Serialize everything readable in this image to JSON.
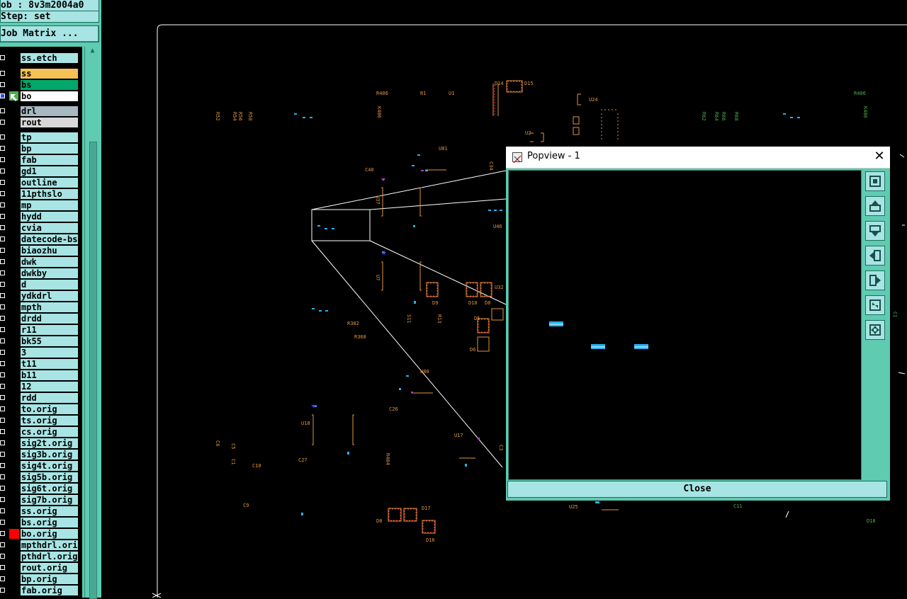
{
  "header": {
    "job": "ob : 8v3m2004a0",
    "step": "Step: set",
    "job_matrix": "Job Matrix ..."
  },
  "layers": [
    {
      "name": "ss.etch",
      "bg": "#a8e4e4"
    },
    {
      "name": "ss",
      "bg": "#f4c256"
    },
    {
      "name": "bs",
      "bg": "#00a86b"
    },
    {
      "name": "bo",
      "bg": "#ffffff",
      "active": true
    },
    {
      "name": "drl",
      "bg": "#a8b8c0"
    },
    {
      "name": "rout",
      "bg": "#d8d8d8"
    },
    {
      "name": "tp"
    },
    {
      "name": "bp"
    },
    {
      "name": "fab"
    },
    {
      "name": "gd1"
    },
    {
      "name": "outline"
    },
    {
      "name": "11pthslo"
    },
    {
      "name": "mp"
    },
    {
      "name": "hydd"
    },
    {
      "name": "cvia"
    },
    {
      "name": "datecode-bs"
    },
    {
      "name": "biaozhu"
    },
    {
      "name": "dwk"
    },
    {
      "name": "dwkby"
    },
    {
      "name": "d"
    },
    {
      "name": "ydkdrl"
    },
    {
      "name": "mpth"
    },
    {
      "name": "drdd"
    },
    {
      "name": "r11"
    },
    {
      "name": "bk55"
    },
    {
      "name": "3"
    },
    {
      "name": "t11"
    },
    {
      "name": "b11"
    },
    {
      "name": "12"
    },
    {
      "name": "rdd"
    },
    {
      "name": "to.orig"
    },
    {
      "name": "ts.orig"
    },
    {
      "name": "cs.orig"
    },
    {
      "name": "sig2t.orig"
    },
    {
      "name": "sig3b.orig"
    },
    {
      "name": "sig4t.orig"
    },
    {
      "name": "sig5b.orig"
    },
    {
      "name": "sig6t.orig"
    },
    {
      "name": "sig7b.orig"
    },
    {
      "name": "ss.orig"
    },
    {
      "name": "bs.orig"
    },
    {
      "name": "bo.orig",
      "marker": "#ff0000"
    },
    {
      "name": "mpthdrl.orig"
    },
    {
      "name": "pthdrl.orig"
    },
    {
      "name": "rout.orig"
    },
    {
      "name": "bp.orig"
    },
    {
      "name": "fab.orig"
    }
  ],
  "board_labels": {
    "orange": [
      "R406",
      "R43",
      "R52",
      "R54",
      "R58",
      "U8",
      "C40",
      "C38",
      "U7",
      "D8",
      "D10",
      "D6",
      "D9",
      "R382",
      "R368",
      "C26",
      "U18",
      "C27",
      "C9",
      "C10",
      "C6",
      "C5",
      "U17",
      "D16",
      "D17",
      "D15",
      "D14",
      "U15",
      "U24",
      "U2",
      "C3",
      "R406",
      "R402"
    ],
    "green": [
      "R60",
      "R64",
      "R58",
      "R406",
      "R402",
      "C3",
      "D8",
      "C1"
    ]
  },
  "popview": {
    "title": "Popview - 1",
    "close_label": "Close",
    "tools": [
      "fit-icon",
      "pan-up-icon",
      "pan-down-icon",
      "pan-left-icon",
      "pan-right-icon",
      "zoom-out-icon",
      "zoom-in-icon"
    ]
  },
  "colors": {
    "panel": "#5fcbb0",
    "button": "#a8e4e4",
    "canvas": "#000000",
    "pad_blue": "#2ab0f0",
    "silk_orange": "#e09640",
    "silk_green": "#4caf50",
    "zoom_lines": "#ffffff"
  }
}
